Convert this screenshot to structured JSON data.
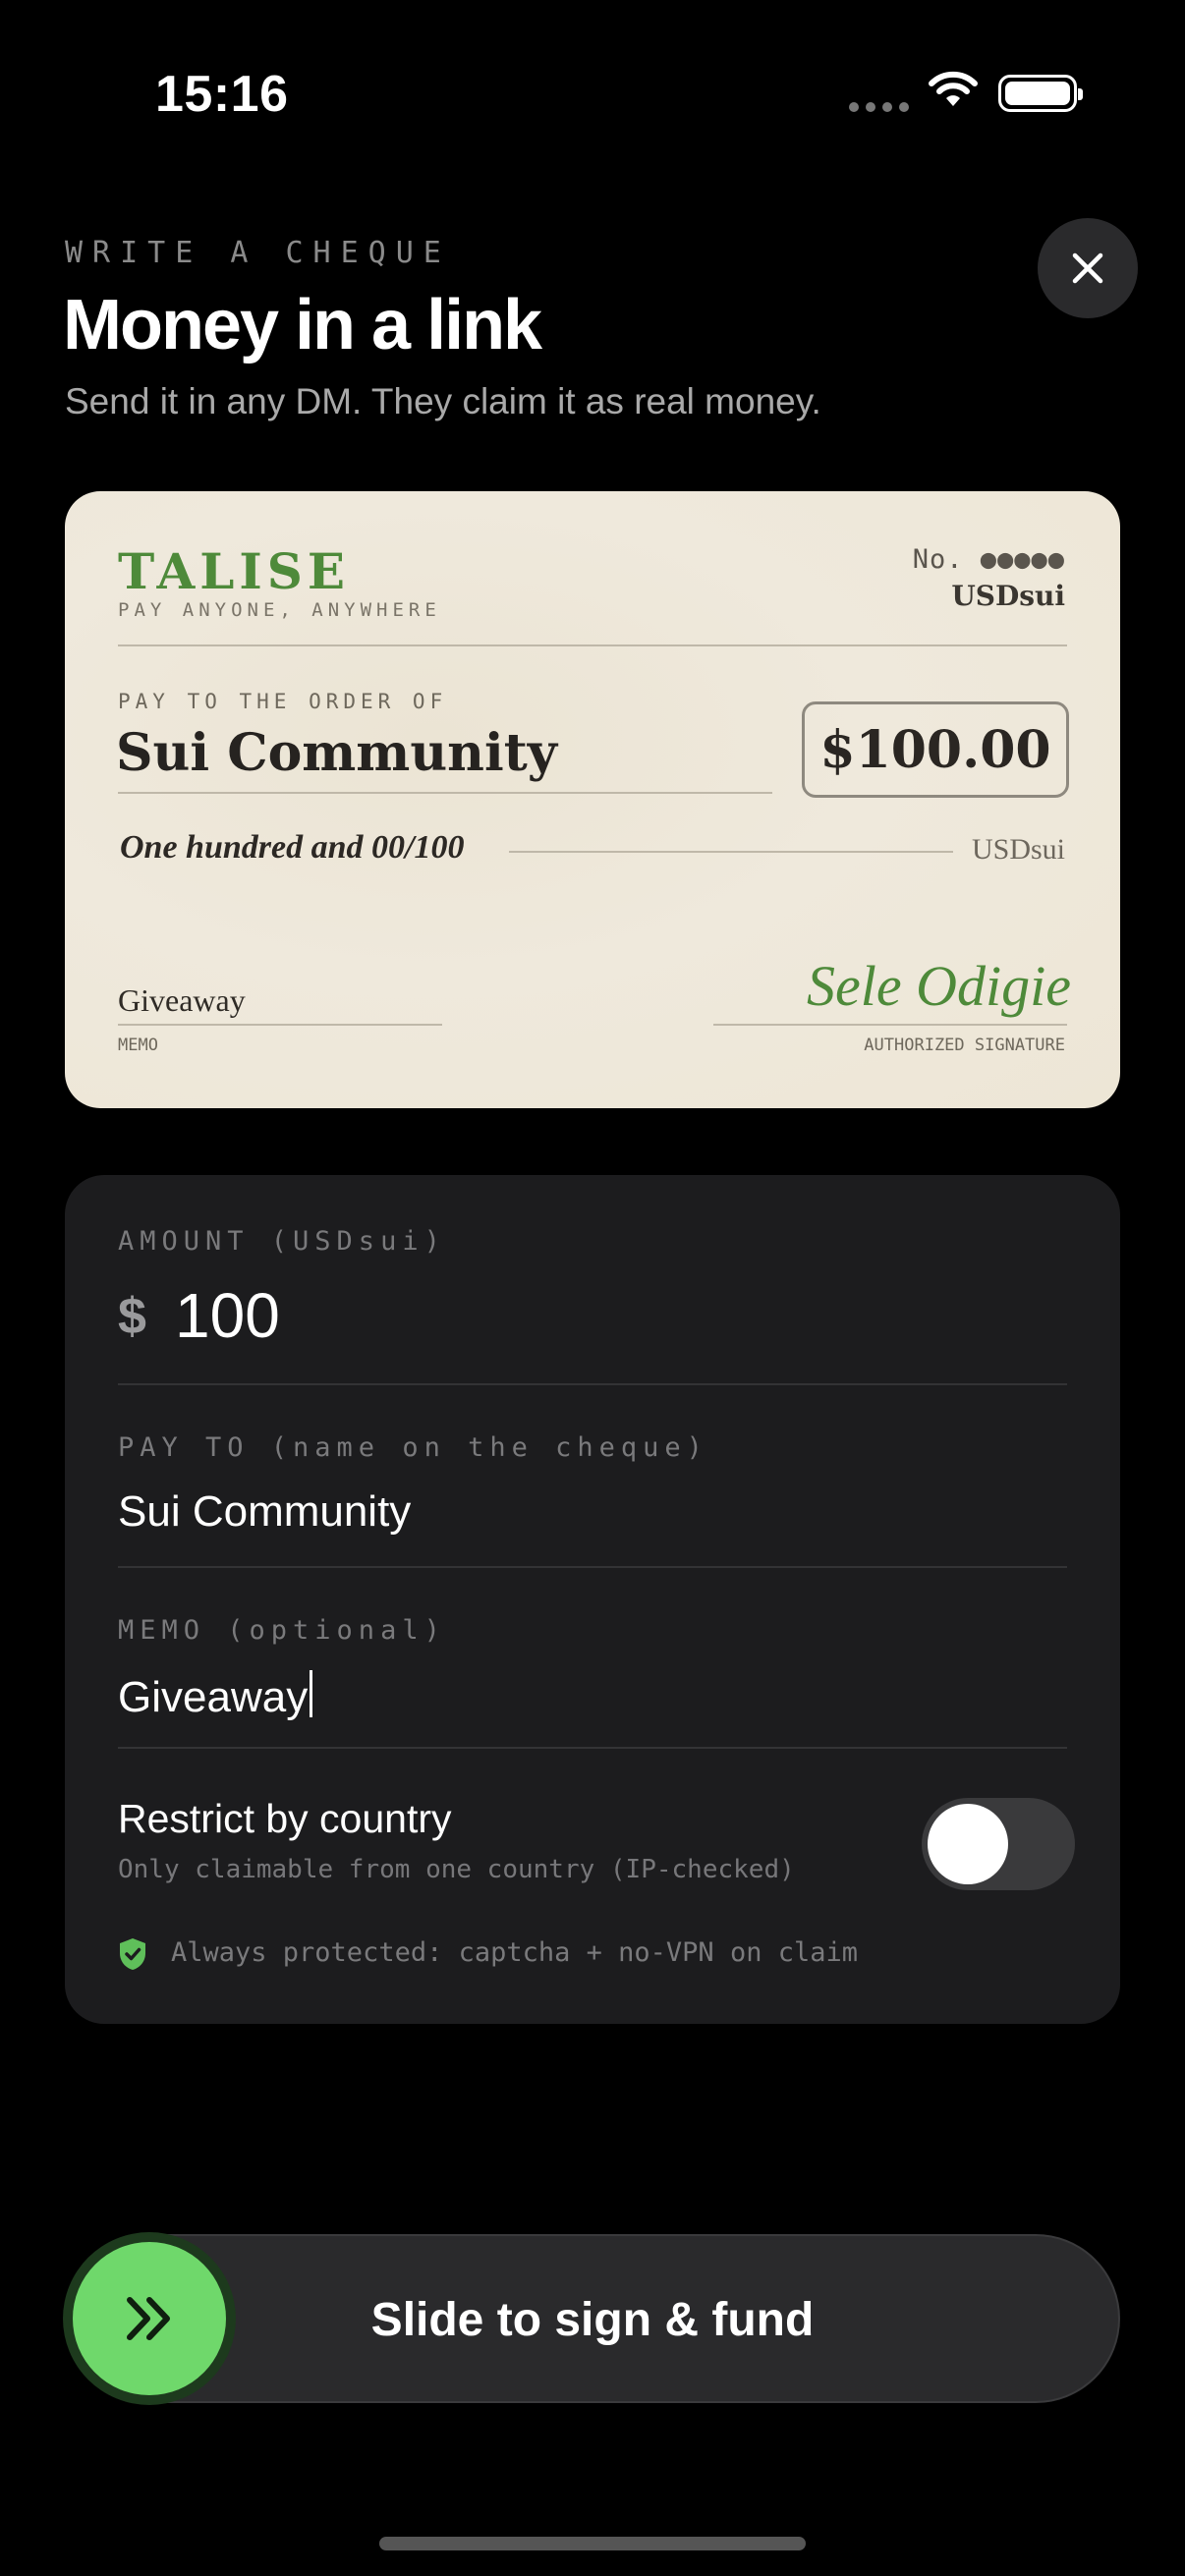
{
  "status_bar": {
    "time": "15:16"
  },
  "header": {
    "eyebrow": "WRITE A CHEQUE",
    "title": "Money in a link",
    "subtitle": "Send it in any DM. They claim it as real money."
  },
  "cheque": {
    "brand": "TALISE",
    "brand_tagline": "PAY ANYONE, ANYWHERE",
    "number": "No. ●●●●●",
    "currency": "USDsui",
    "pay_to_label": "PAY TO THE ORDER OF",
    "payee": "Sui Community",
    "amount": "$100.00",
    "amount_words": "One hundred and 00/100",
    "words_currency": "USDsui",
    "memo": "Giveaway",
    "memo_label": "MEMO",
    "signature": "Sele Odigie",
    "signature_label": "AUTHORIZED SIGNATURE",
    "brand_color": "#4e8a3a"
  },
  "form": {
    "amount_label": "AMOUNT (USDsui)",
    "currency_symbol": "$",
    "amount_value": "100",
    "pay_to_label": "PAY TO (name on the cheque)",
    "pay_to_value": "Sui Community",
    "memo_label": "MEMO (optional)",
    "memo_value": "Giveaway",
    "restrict_title": "Restrict by country",
    "restrict_subtitle": "Only claimable from one country (IP-checked)",
    "restrict_enabled": false,
    "protection_note": "Always protected: captcha + no-VPN on claim"
  },
  "slider": {
    "label": "Slide to sign & fund",
    "accent": "#6fd86b"
  },
  "icons": [
    "wifi-icon",
    "battery-icon",
    "close-icon",
    "shield-check-icon",
    "chevrons-right-icon"
  ]
}
